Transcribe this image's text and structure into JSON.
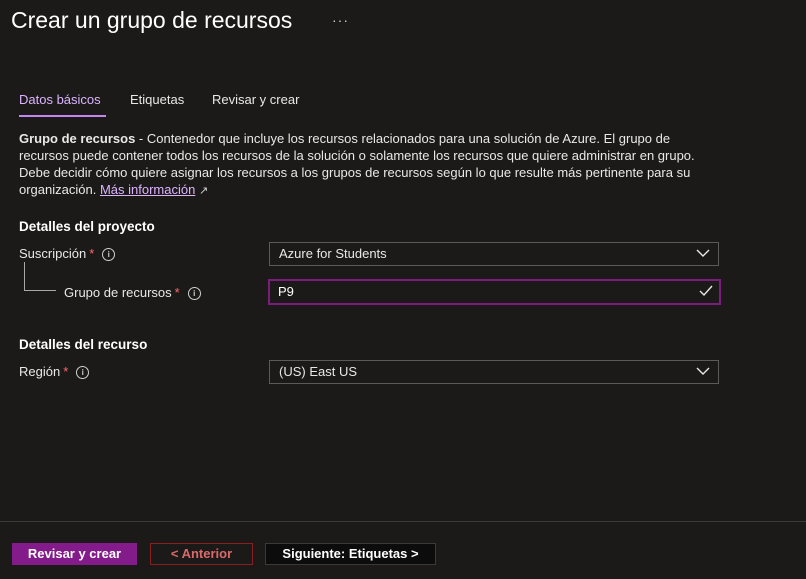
{
  "header": {
    "title": "Crear un grupo de recursos",
    "more": "···"
  },
  "tabs": [
    {
      "label": "Datos básicos",
      "active": true
    },
    {
      "label": "Etiquetas",
      "active": false
    },
    {
      "label": "Revisar y crear",
      "active": false
    }
  ],
  "description": {
    "term": "Grupo de recursos",
    "text": " - Contenedor que incluye los recursos relacionados para una solución de Azure. El grupo de recursos puede contener todos los recursos de la solución o solamente los recursos que quiere administrar en grupo. Debe decidir cómo quiere asignar los recursos a los grupos de recursos según lo que resulte más pertinente para su organización. ",
    "link": "Más información"
  },
  "project": {
    "section_title": "Detalles del proyecto",
    "subscription_label": "Suscripción",
    "subscription_value": "Azure for Students",
    "resource_group_label": "Grupo de recursos",
    "resource_group_value": "P9"
  },
  "resource": {
    "section_title": "Detalles del recurso",
    "region_label": "Región",
    "region_value": "(US) East US"
  },
  "required_marker": "*",
  "footer": {
    "review_create": "Revisar y crear",
    "previous": "< Anterior",
    "next": "Siguiente: Etiquetas >"
  },
  "colors": {
    "accent": "#841b8a",
    "active_tab": "#dcb4ff",
    "required": "#ff6b6b",
    "background": "#1b1a19"
  }
}
